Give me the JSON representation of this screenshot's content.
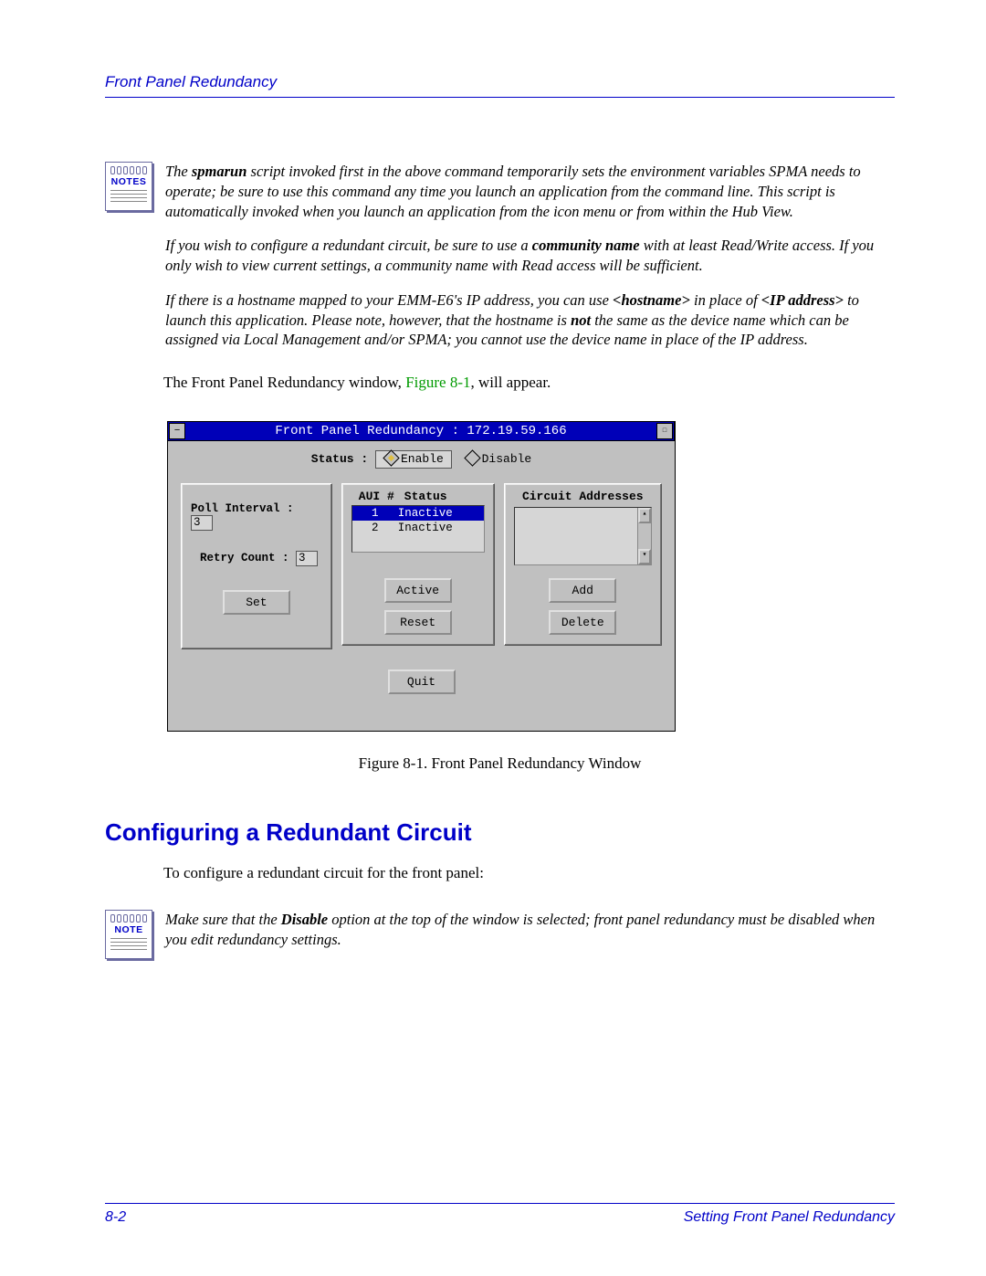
{
  "header": {
    "title": "Front Panel Redundancy"
  },
  "notes": {
    "label_plural": "NOTES",
    "label_single": "NOTE",
    "p1a": "The ",
    "p1b": "spmarun",
    "p1c": " script invoked first in the above command temporarily sets the environment variables SPMA needs to operate; be sure to use this command any time you launch an application from the command line. This script is automatically invoked when you launch an application from the icon menu or from within the Hub View.",
    "p2a": "If you wish to configure a redundant circuit, be sure to use a ",
    "p2b": "community name",
    "p2c": " with at least Read/Write access. If you only wish to view current settings, a community name with Read access will be sufficient.",
    "p3a": "If there is a hostname mapped to your EMM-E6's IP address, you can use ",
    "p3b": "<hostname>",
    "p3c": " in place of ",
    "p3d": "<IP address>",
    "p3e": " to launch this application. Please note, however, that the hostname is ",
    "p3f": "not",
    "p3g": " the same as the device name which can be assigned via Local Management and/or SPMA; you cannot use the device name in place of the IP address."
  },
  "body": {
    "lead_a": "The Front Panel Redundancy window, ",
    "lead_link": "Figure 8-1",
    "lead_b": ", will appear.",
    "caption": "Figure 8-1.  Front Panel Redundancy Window",
    "section": "Configuring a Redundant Circuit",
    "section_lead": "To configure a redundant circuit for the front panel:"
  },
  "note2": {
    "a": "Make sure that the ",
    "b": "Disable",
    "c": " option at the top of the window is selected; front panel redundancy must be disabled when you edit redundancy settings."
  },
  "window": {
    "title": "Front Panel Redundancy : 172.19.59.166",
    "status_label": "Status :",
    "enable": "Enable",
    "disable": "Disable",
    "poll_label": "Poll Interval :",
    "poll_value": "3",
    "retry_label": "Retry Count :",
    "retry_value": "3",
    "set": "Set",
    "aui_h1": "AUI #",
    "aui_h2": "Status",
    "row1_n": "1",
    "row1_s": "Inactive",
    "row2_n": "2",
    "row2_s": "Inactive",
    "active": "Active",
    "reset": "Reset",
    "circ": "Circuit Addresses",
    "add": "Add",
    "delete": "Delete",
    "quit": "Quit"
  },
  "footer": {
    "left": "8-2",
    "right": "Setting Front Panel Redundancy"
  }
}
